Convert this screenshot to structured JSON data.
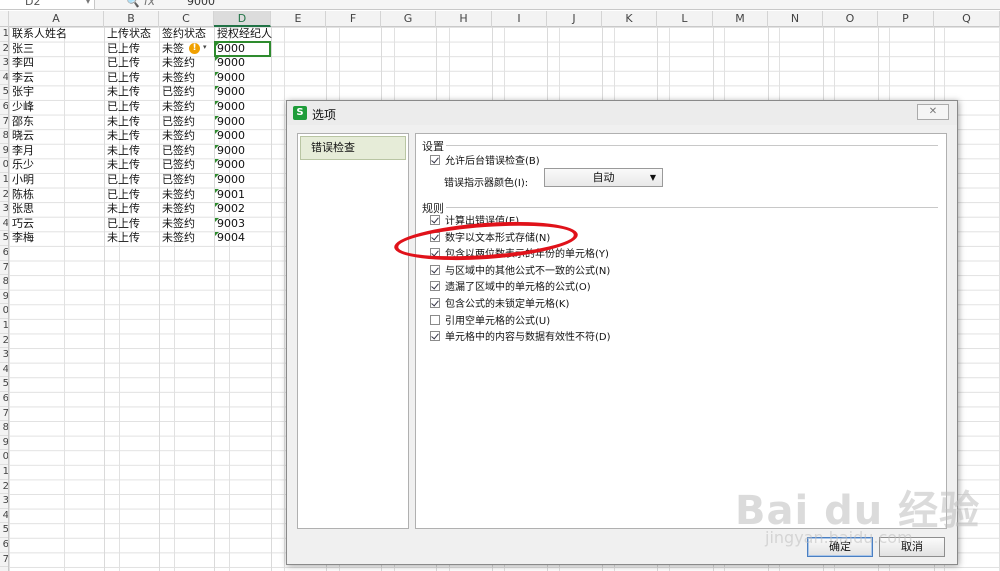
{
  "formula_bar": {
    "cell_ref": "D2",
    "fx": "fx",
    "value": "9000"
  },
  "columns": [
    "A",
    "B",
    "C",
    "D",
    "E",
    "F",
    "G",
    "H",
    "I",
    "J",
    "K",
    "L",
    "M",
    "N",
    "O",
    "P",
    "Q"
  ],
  "row_numbers": [
    "1",
    "2",
    "3",
    "4",
    "5",
    "6",
    "7",
    "8",
    "9",
    "0",
    "1",
    "2",
    "3",
    "4",
    "5",
    "6",
    "7",
    "8",
    "9",
    "0",
    "1",
    "2",
    "3",
    "4",
    "5",
    "6",
    "7",
    "8",
    "9",
    "0",
    "1",
    "2",
    "3",
    "4",
    "5",
    "6",
    "7"
  ],
  "headers": {
    "a": "联系人姓名",
    "b": "上传状态",
    "c": "签约状态",
    "d": "授权经纪人"
  },
  "rows": [
    {
      "a": "张三",
      "b": "已上传",
      "c": "未签",
      "d": "9000"
    },
    {
      "a": "李四",
      "b": "已上传",
      "c": "未签约",
      "d": "9000"
    },
    {
      "a": "李云",
      "b": "已上传",
      "c": "未签约",
      "d": "9000"
    },
    {
      "a": "张宇",
      "b": "未上传",
      "c": "已签约",
      "d": "9000"
    },
    {
      "a": "少峰",
      "b": "已上传",
      "c": "未签约",
      "d": "9000"
    },
    {
      "a": "邵东",
      "b": "未上传",
      "c": "已签约",
      "d": "9000"
    },
    {
      "a": "晓云",
      "b": "未上传",
      "c": "未签约",
      "d": "9000"
    },
    {
      "a": "李月",
      "b": "未上传",
      "c": "已签约",
      "d": "9000"
    },
    {
      "a": "乐少",
      "b": "未上传",
      "c": "已签约",
      "d": "9000"
    },
    {
      "a": "小明",
      "b": "已上传",
      "c": "已签约",
      "d": "9000"
    },
    {
      "a": "陈栋",
      "b": "已上传",
      "c": "未签约",
      "d": "9001"
    },
    {
      "a": "张思",
      "b": "未上传",
      "c": "未签约",
      "d": "9002"
    },
    {
      "a": "巧云",
      "b": "已上传",
      "c": "未签约",
      "d": "9003"
    },
    {
      "a": "李梅",
      "b": "未上传",
      "c": "未签约",
      "d": "9004"
    }
  ],
  "dialog": {
    "title": "选项",
    "close": "✕",
    "nav": [
      "错误检查"
    ],
    "settings_title": "设置",
    "allow_background": "允许后台错误检查(B)",
    "indicator_color_label": "错误指示器颜色(I):",
    "indicator_color_value": "自动",
    "rules_title": "规则",
    "rules": [
      {
        "label": "计算出错误值(E)",
        "checked": true
      },
      {
        "label": "数字以文本形式存储(N)",
        "checked": true
      },
      {
        "label": "包含以两位数表示的年份的单元格(Y)",
        "checked": true
      },
      {
        "label": "与区域中的其他公式不一致的公式(N)",
        "checked": true
      },
      {
        "label": "遗漏了区域中的单元格的公式(O)",
        "checked": true
      },
      {
        "label": "包含公式的未锁定单元格(K)",
        "checked": true
      },
      {
        "label": "引用空单元格的公式(U)",
        "checked": false
      },
      {
        "label": "单元格中的内容与数据有效性不符(D)",
        "checked": true
      }
    ],
    "ok": "确定",
    "cancel": "取消"
  },
  "watermark": {
    "main": "Bai du 经验",
    "sub": "jingyan.baidu.com"
  },
  "colors": {
    "selection": "#2e8b2e",
    "annotation": "#e0121a",
    "app_icon": "#1f9d3a"
  }
}
